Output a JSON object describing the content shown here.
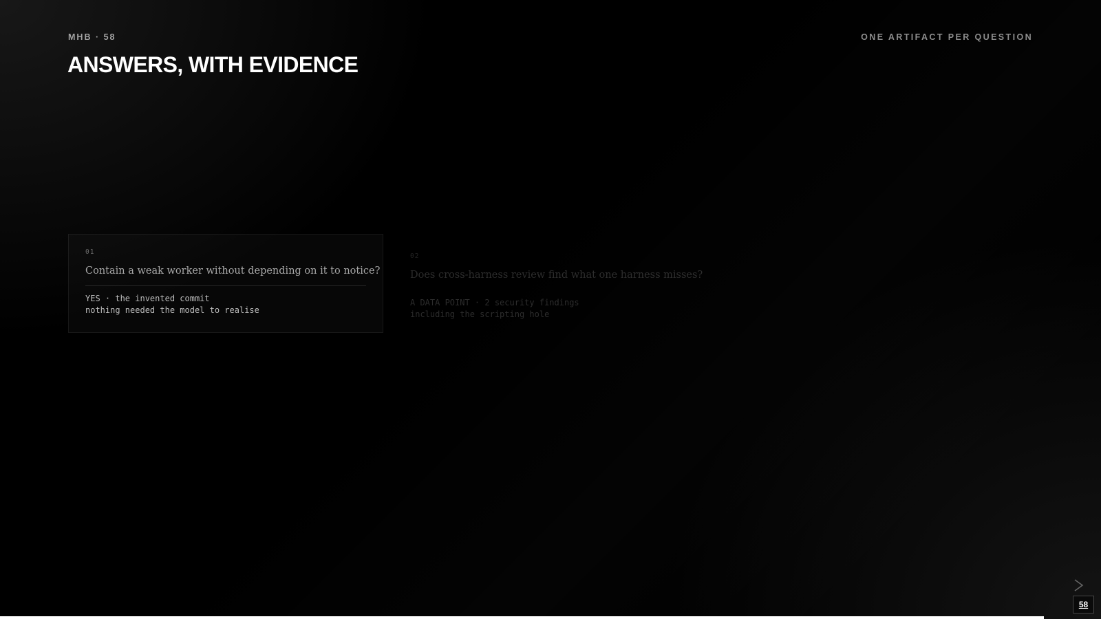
{
  "header": {
    "eyebrow": "MHB · 58",
    "title": "ANSWERS, WITH EVIDENCE",
    "tagline": "ONE ARTIFACT PER QUESTION"
  },
  "cards": [
    {
      "number": "01",
      "question": "Contain a weak worker without depending on it to notice?",
      "answer": "YES · the invented commit\nnothing needed the model to realise"
    },
    {
      "number": "02",
      "question": "Does cross-harness review find what one harness misses?",
      "answer": "A DATA POINT · 2 security findings\nincluding the scripting hole"
    }
  ],
  "footer": {
    "page_number": "58",
    "progress": 0.948,
    "next_icon": "chevron-right-icon"
  }
}
